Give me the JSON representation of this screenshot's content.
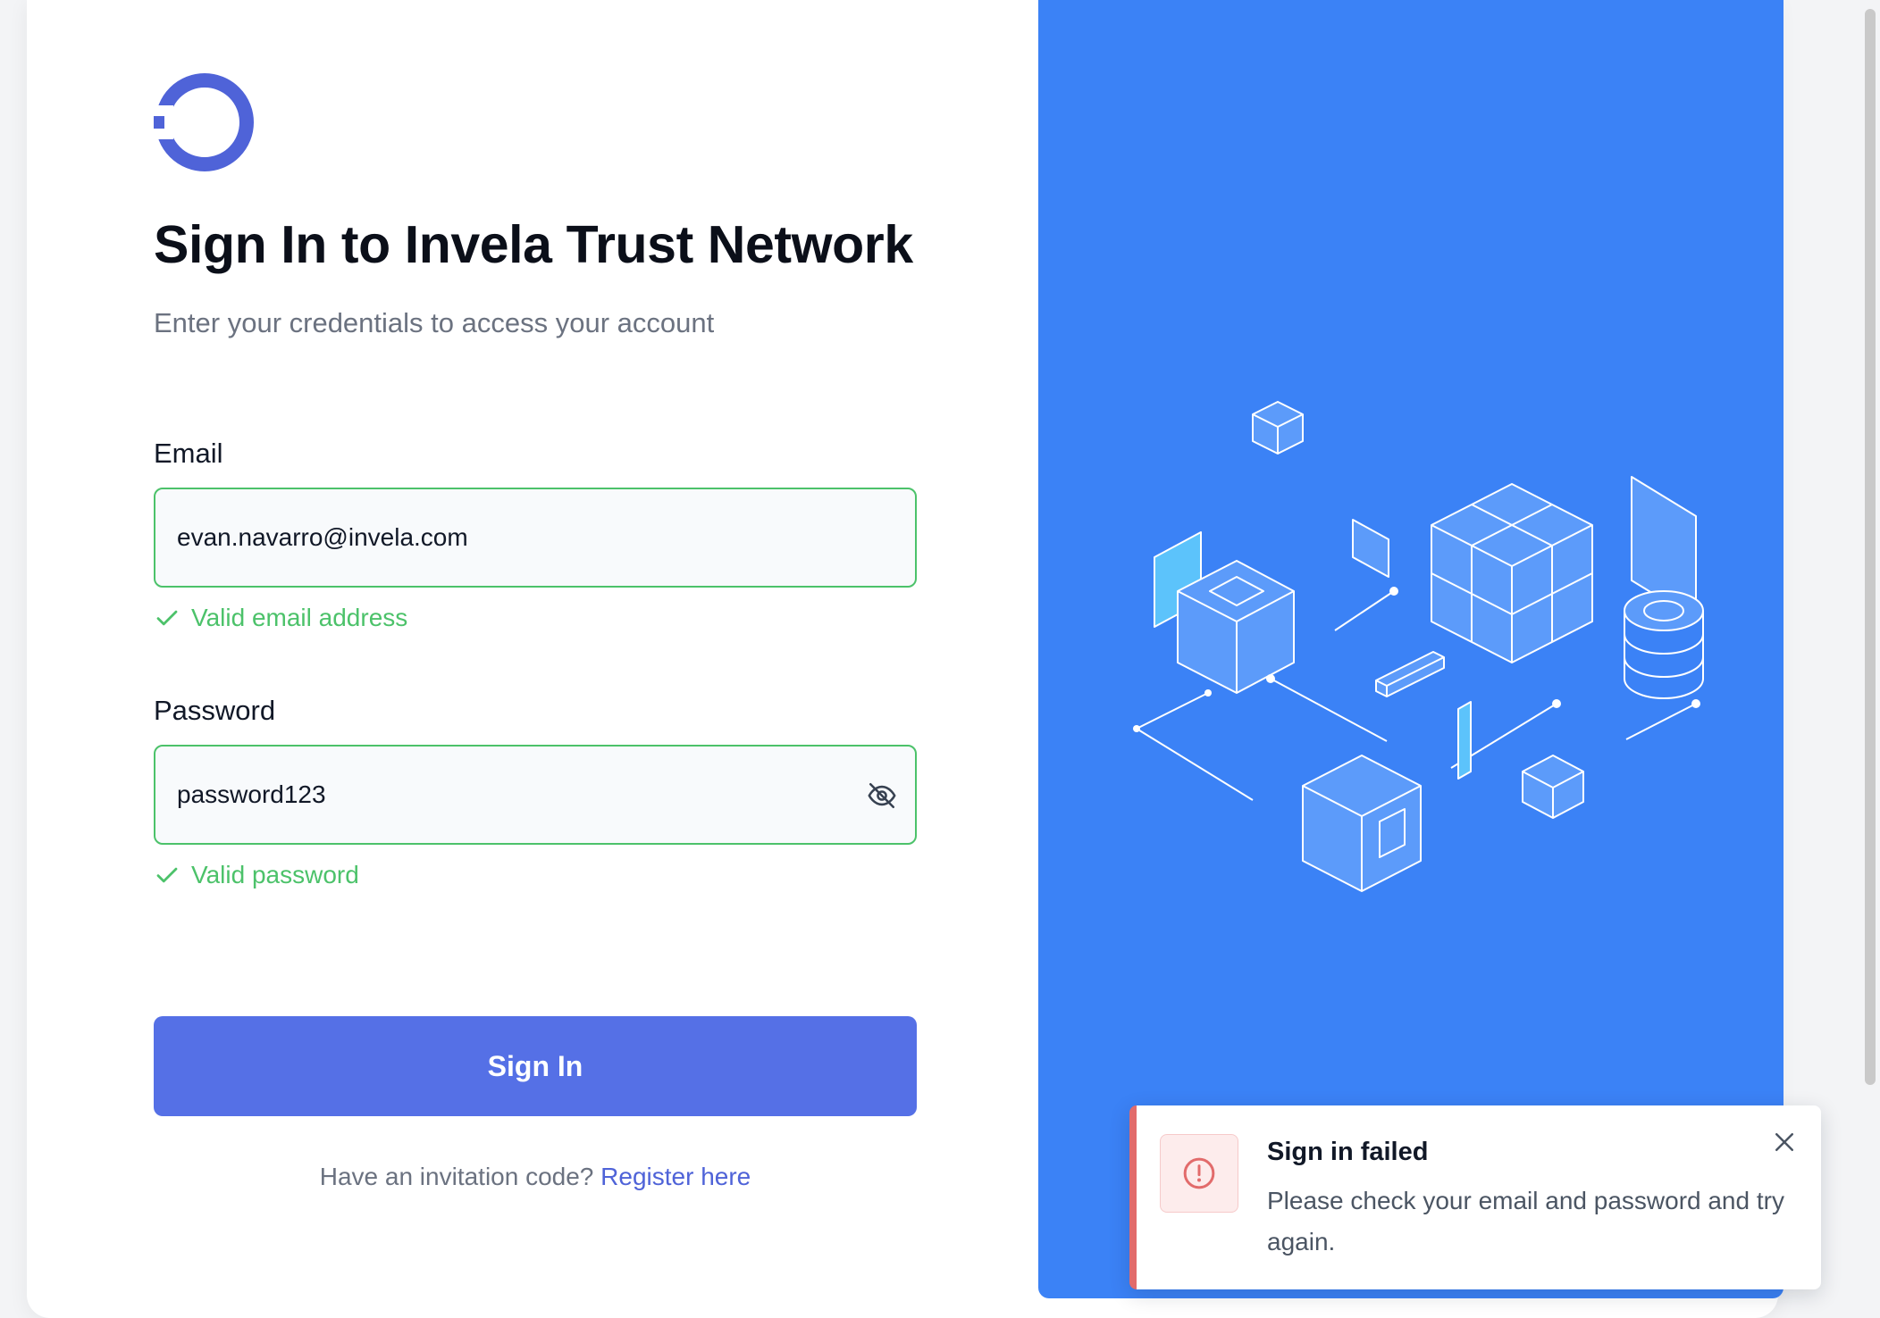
{
  "login": {
    "title": "Sign In to Invela Trust Network",
    "subtitle": "Enter your credentials to access your account",
    "email": {
      "label": "Email",
      "value": "evan.navarro@invela.com",
      "validation": "Valid email address"
    },
    "password": {
      "label": "Password",
      "value": "password123",
      "validation": "Valid password",
      "toggle_icon": "eye-off-icon"
    },
    "submit_label": "Sign In",
    "invite_prompt": "Have an invitation code?",
    "register_link": "Register here"
  },
  "toast": {
    "title": "Sign in failed",
    "message": "Please check your email and password and try again.",
    "icon": "alert-circle-icon"
  },
  "colors": {
    "primary": "#5570e6",
    "brand_logo": "#4f63d8",
    "panel": "#3b82f6",
    "valid": "#4cc26a",
    "error": "#e26b6b"
  }
}
